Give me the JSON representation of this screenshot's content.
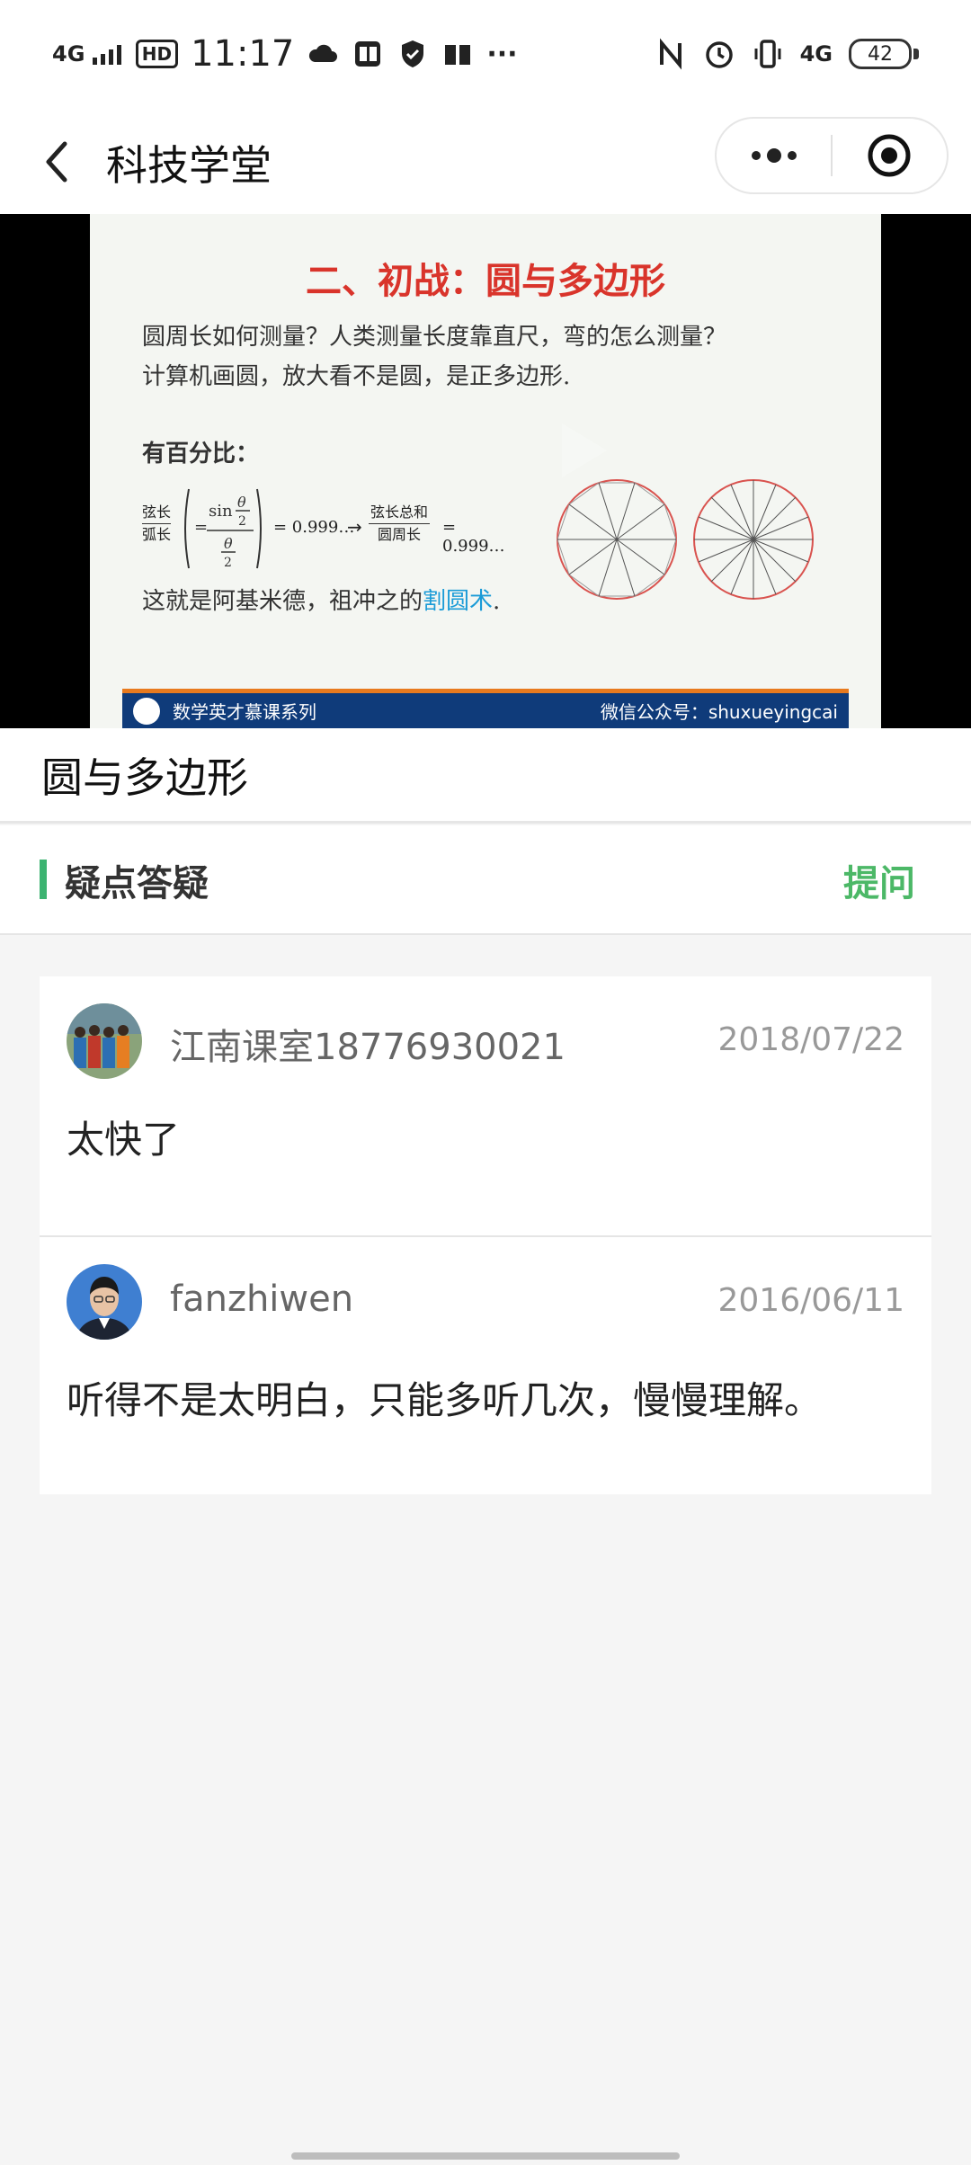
{
  "status_bar": {
    "network_left": "4G",
    "hd": "HD",
    "time": "11:17",
    "network_right": "4G",
    "battery": "42"
  },
  "nav": {
    "title": "科技学堂"
  },
  "slide": {
    "title": "二、初战：圆与多边形",
    "line1": "圆周长如何测量？人类测量长度靠直尺，弯的怎么测量？",
    "line2": "计算机画圆，放大看不是圆，是正多边形.",
    "line3": "有百分比：",
    "line4_prefix": "这就是阿基米德，祖冲之的",
    "line4_highlight": "割圆术",
    "line4_suffix": ".",
    "formula_num1": "弦长",
    "formula_den1": "弧长",
    "formula_value1": "= 0.999…",
    "formula_num2": "弦长总和",
    "formula_den2": "圆周长",
    "formula_value2": "= 0.999…",
    "footer_left": "数学英才慕课系列",
    "footer_right": "微信公众号：shuxueyingcai"
  },
  "lesson": {
    "title": "圆与多边形"
  },
  "qa": {
    "title": "疑点答疑",
    "ask_label": "提问"
  },
  "comments": [
    {
      "name": "江南课室18776930021",
      "date": "2018/07/22",
      "text": "太快了"
    },
    {
      "name": "fanzhiwen",
      "date": "2016/06/11",
      "text": "听得不是太明白，只能多听几次，慢慢理解。"
    }
  ]
}
